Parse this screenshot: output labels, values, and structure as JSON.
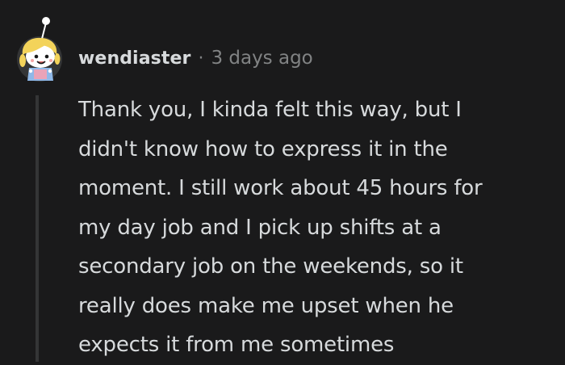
{
  "comment": {
    "username": "wendiaster",
    "separator": "·",
    "timestamp": "3 days ago",
    "avatar_icon": "snoo-avatar-icon",
    "lines": [
      "Thank you, I kinda felt this way, but I",
      "didn't know how to express it in the",
      "moment. I still work about 45 hours for",
      "my day job and I pick up shifts at a",
      "secondary job on the weekends, so it",
      "really does make me upset when he",
      "expects it from me sometimes"
    ]
  },
  "colors": {
    "background": "#1a1a1b",
    "text": "#d7dadc",
    "meta_text": "#818384",
    "thread_line": "#343536",
    "avatar_bg": "#3a3a3c"
  }
}
